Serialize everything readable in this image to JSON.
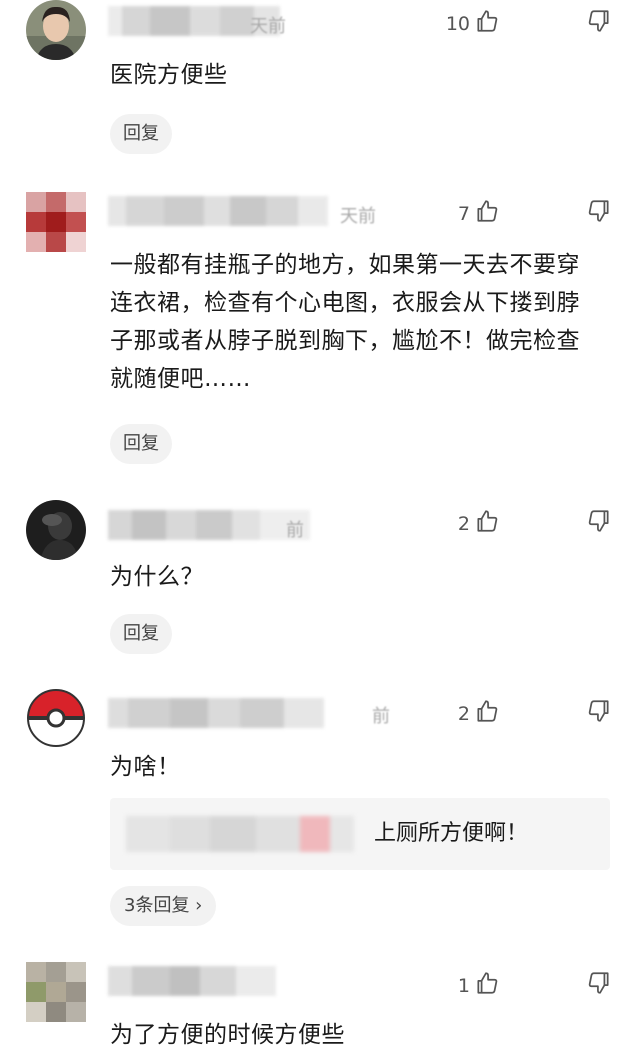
{
  "comments": [
    {
      "time": "天前",
      "likes": "10",
      "text": "医院方便些",
      "reply_label": "回复"
    },
    {
      "time": "天前",
      "likes": "7",
      "text": "一般都有挂瓶子的地方，如果第一天去不要穿连衣裙，检查有个心电图，衣服会从下搂到脖子那或者从脖子脱到胸下，尴尬不！做完检查就随便吧……",
      "reply_label": "回复"
    },
    {
      "time": "前",
      "likes": "2",
      "text": "为什么？",
      "reply_label": "回复"
    },
    {
      "time": "前",
      "likes": "2",
      "text": "为啥！",
      "nested_reply_text": "上厕所方便啊！",
      "more_replies_label": "3条回复 ›"
    },
    {
      "likes": "1",
      "text": "为了方便的时候方便些"
    }
  ],
  "colors": {
    "text": "#1a1a1a",
    "muted": "#555555",
    "pill_bg": "#f2f2f2"
  },
  "icons": {
    "like": "thumb-up-icon",
    "dislike": "thumb-down-icon"
  }
}
